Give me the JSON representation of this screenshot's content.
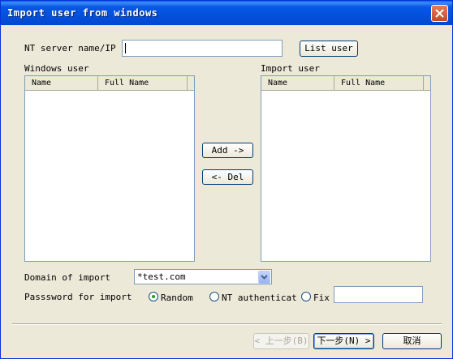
{
  "window": {
    "title": "Import user from windows"
  },
  "server": {
    "label": "NT server name/IP",
    "value": "",
    "list_button": "List user"
  },
  "windows_user": {
    "label": "Windows user",
    "columns": [
      "Name",
      "Full Name"
    ]
  },
  "import_user": {
    "label": "Import user",
    "columns": [
      "Name",
      "Full Name"
    ]
  },
  "buttons": {
    "add": "Add ->",
    "del": "<- Del"
  },
  "domain": {
    "label": "Domain of import",
    "value": "*test.com"
  },
  "password": {
    "label": "Passsword for import",
    "options": [
      "Random",
      "NT authenticat",
      "Fix"
    ],
    "selected": "Random",
    "fix_value": ""
  },
  "footer": {
    "prev": "< 上一步(B)",
    "next": "下一步(N) >",
    "cancel": "取消"
  }
}
